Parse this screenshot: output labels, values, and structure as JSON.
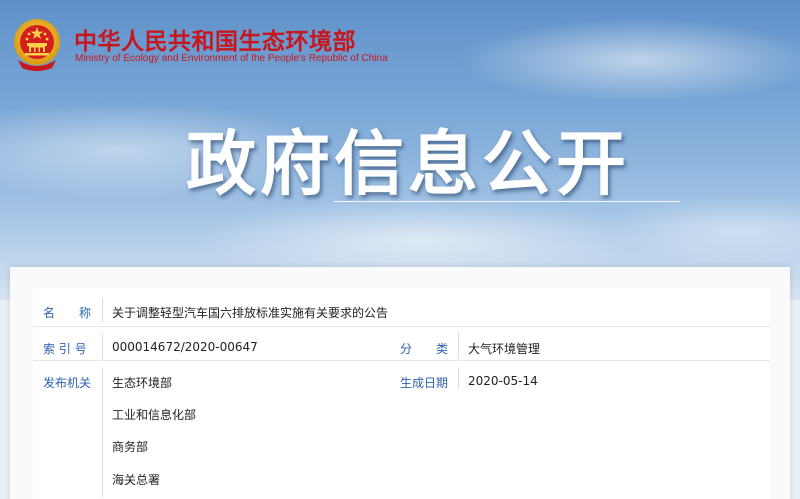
{
  "header": {
    "ministry_name_cn": "中华人民共和国生态环境部",
    "ministry_name_en": "Ministry of Ecology and Environment of the People's Republic of China",
    "page_title": "政府信息公开"
  },
  "info": {
    "name_label": "名　　称",
    "name_value": "关于调整轻型汽车国六排放标准实施有关要求的公告",
    "index_label": "索 引 号",
    "index_value": "000014672/2020-00647",
    "category_label": "分　　类",
    "category_value": "大气环境管理",
    "issuer_label": "发布机关",
    "issuers": [
      "生态环境部",
      "工业和信息化部",
      "商务部",
      "海关总署"
    ],
    "date_label": "生成日期",
    "date_value": "2020-05-14"
  },
  "colors": {
    "brand_red": "#c8161d",
    "label_blue": "#2c62b0"
  }
}
